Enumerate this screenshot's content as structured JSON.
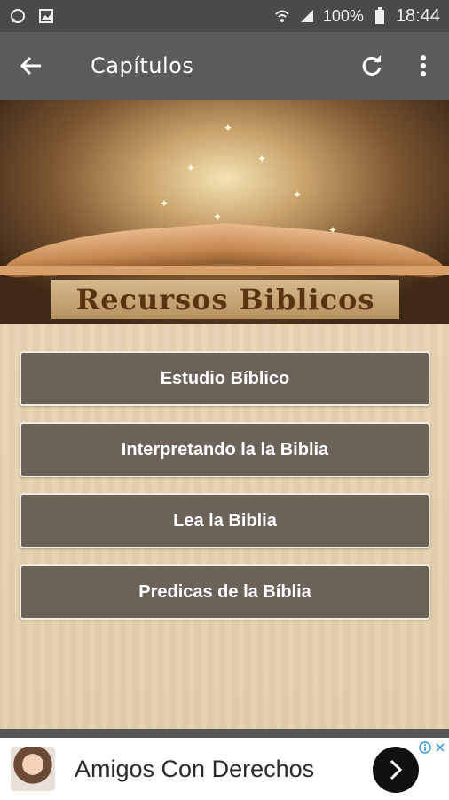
{
  "status_bar": {
    "battery": "100%",
    "time": "18:44",
    "icons": [
      "whatsapp-icon",
      "image-icon",
      "wifi-icon",
      "signal-icon",
      "battery-icon"
    ]
  },
  "app_bar": {
    "title": "Capítulos",
    "icons": [
      "back-arrow-icon",
      "refresh-icon",
      "more-vert-icon"
    ]
  },
  "banner": {
    "logo_text": "Recursos Biblicos"
  },
  "menu": {
    "items": [
      {
        "label": "Estudio Bíblico"
      },
      {
        "label": "Interpretando la la Biblia"
      },
      {
        "label": "Lea la Biblia"
      },
      {
        "label": "Predicas de la Bíblia"
      }
    ]
  },
  "ad": {
    "text": "Amigos Con Derechos",
    "icons": [
      "info-icon",
      "close-icon",
      "chevron-right-icon"
    ]
  },
  "colors": {
    "app_bar": "#5b5b5b",
    "button": "#6b6358",
    "content_bg": "#e6d5b4"
  }
}
